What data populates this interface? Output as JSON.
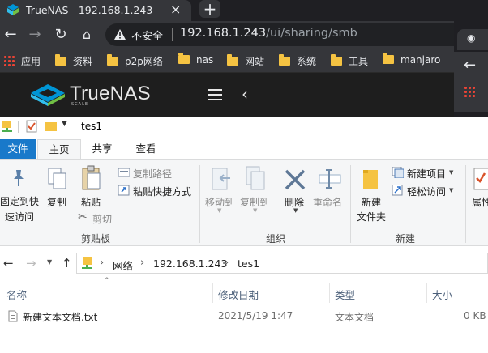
{
  "browser": {
    "tab_title": "TrueNAS - 192.168.1.243",
    "insecure_label": "不安全",
    "url_host": "192.168.1.243",
    "url_path": "/ui/sharing/smb",
    "bookmarks": [
      {
        "label": "应用",
        "icon": "apps-grid-icon"
      },
      {
        "label": "资料",
        "icon": "folder-icon"
      },
      {
        "label": "p2p网络",
        "icon": "folder-icon"
      },
      {
        "label": "nas",
        "icon": "folder-icon"
      },
      {
        "label": "网站",
        "icon": "folder-icon"
      },
      {
        "label": "系统",
        "icon": "folder-icon"
      },
      {
        "label": "工具",
        "icon": "folder-icon"
      },
      {
        "label": "manjaro",
        "icon": "folder-icon"
      }
    ]
  },
  "truenas": {
    "brand": "TrueNAS",
    "edition": "SCALE"
  },
  "explorer": {
    "window_title": "tes1",
    "ribbon_tabs": [
      "文件",
      "主页",
      "共享",
      "查看"
    ],
    "clipboard": {
      "pin_label_1": "固定到快",
      "pin_label_2": "速访问",
      "copy_label": "复制",
      "paste_label": "粘贴",
      "copy_path_label": "复制路径",
      "paste_shortcut_label": "粘贴快捷方式",
      "cut_label": "剪切",
      "group_label": "剪贴板"
    },
    "organize": {
      "move_to_label": "移动到",
      "copy_to_label": "复制到",
      "delete_label": "删除",
      "rename_label": "重命名",
      "group_label": "组织"
    },
    "new": {
      "new_folder_label_1": "新建",
      "new_folder_label_2": "文件夹",
      "new_item_label": "新建项目",
      "easy_access_label": "轻松访问",
      "group_label": "新建"
    },
    "open": {
      "properties_label": "属性"
    },
    "breadcrumb": [
      "网络",
      "192.168.1.243",
      "tes1"
    ],
    "columns": [
      "名称",
      "修改日期",
      "类型",
      "大小"
    ],
    "files": [
      {
        "name": "新建文本文档.txt",
        "modified": "2021/5/19 1:47",
        "type": "文本文档",
        "size": "0 KB"
      }
    ]
  }
}
